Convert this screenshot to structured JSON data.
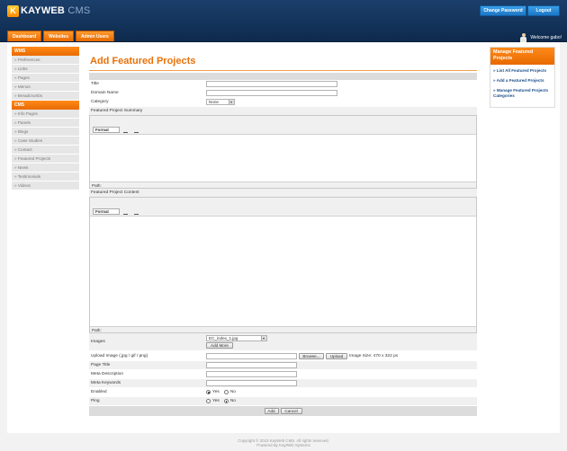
{
  "header": {
    "logo_text": "KAYWEB",
    "logo_suffix": "CMS",
    "change_password_label": "Change Password",
    "logout_label": "Logout",
    "welcome_text": "Welcome gabo!"
  },
  "nav": {
    "tabs": [
      {
        "label": "Dashboard"
      },
      {
        "label": "Websites"
      },
      {
        "label": "Admin Users"
      }
    ]
  },
  "sidebar": {
    "wms_heading": "WMS",
    "wms_items": [
      {
        "label": "» Preferences"
      },
      {
        "label": "» Links"
      },
      {
        "label": "» Pages"
      },
      {
        "label": "» Menus"
      },
      {
        "label": "» Breadcrumbs"
      }
    ],
    "cms_heading": "CMS",
    "cms_items": [
      {
        "label": "» Info Pages"
      },
      {
        "label": "» Panels"
      },
      {
        "label": "» Blogs"
      },
      {
        "label": "» Case Studies"
      },
      {
        "label": "» Contact"
      },
      {
        "label": "» Featured Projects"
      },
      {
        "label": "» News"
      },
      {
        "label": "» Testimonials"
      },
      {
        "label": "» Videos"
      }
    ]
  },
  "form": {
    "page_title": "Add Featured Projects",
    "title_label": "Title",
    "domain_label": "Domain Name",
    "category_label": "Category",
    "category_value": "None",
    "summary_label": "Featured Project Summary",
    "content_label": "Featured Project Content",
    "format_label": "Format",
    "path_label": "Path:",
    "images_label": "Images",
    "images_value": "EC_index_1.jpg",
    "add_more_label": "Add More",
    "upload_label": "Upload Image (.jpg / gif / png)",
    "browse_label": "Browse...",
    "upload_button_label": "Upload",
    "image_size_text": "Image Size: 470 x 322 px",
    "page_title_label": "Page Title",
    "meta_description_label": "Meta Description",
    "meta_keywords_label": "Meta Keywords",
    "enabled_label": "Enabled",
    "ping_label": "Ping",
    "yes_label": "Yes",
    "no_label": "No",
    "enabled_value": "Yes",
    "ping_value": "No",
    "add_button_label": "Add",
    "cancel_button_label": "Cancel"
  },
  "right_panel": {
    "heading": "Manage Featured Projects",
    "links": [
      {
        "label": "» List All Featured Projects"
      },
      {
        "label": "» Add a Featured Projects"
      },
      {
        "label": "» Manage Featured Projects Categories"
      }
    ]
  },
  "footer": {
    "copyright": "Copyright © 2013 KayWeb CMS. All rights reserved.",
    "powered_by": "Powered By KayWeb Systems"
  },
  "colors": {
    "header_bg": "#0e2a4d",
    "accent_orange": "#e86a00",
    "button_blue": "#1d76c4",
    "link_blue": "#1d4f8a"
  }
}
